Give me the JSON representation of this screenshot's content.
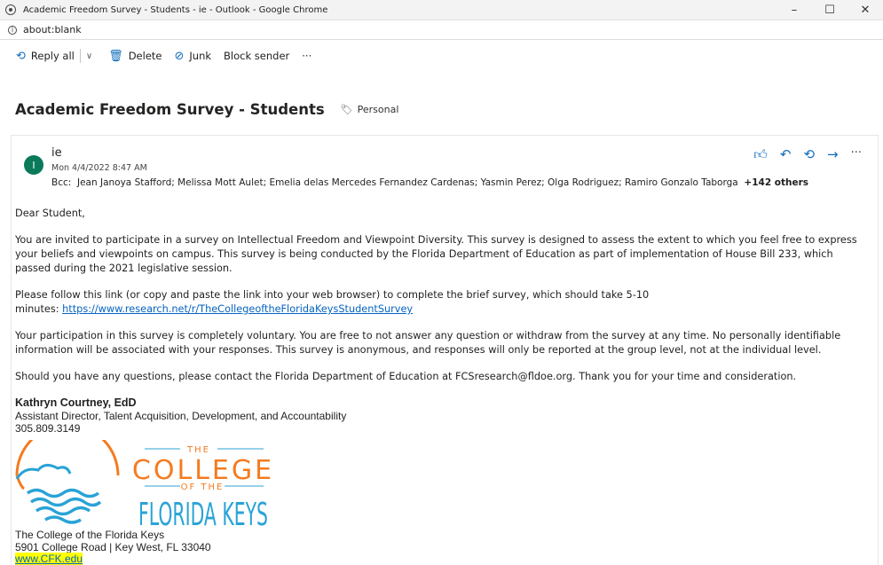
{
  "window": {
    "title": "Academic Freedom Survey - Students - ie - Outlook - Google Chrome",
    "minimize": "–",
    "maximize": "☐",
    "close": "✕"
  },
  "address": {
    "url": "about:blank"
  },
  "toolbar": {
    "reply_all": "Reply all",
    "delete": "Delete",
    "junk": "Junk",
    "block_sender": "Block sender",
    "more": "···"
  },
  "subject": {
    "text": "Academic Freedom Survey - Students",
    "tag": "Personal"
  },
  "message": {
    "avatar_initial": "I",
    "sender": "ie",
    "date": "Mon 4/4/2022 8:47 AM",
    "bcc_label": "Bcc:",
    "bcc_recipients": "Jean Janoya Stafford;  Melissa Mott Aulet;  Emelia delas Mercedes Fernandez Cardenas;  Yasmin Perez;  Olga Rodriguez;  Ramiro Gonzalo Taborga",
    "bcc_more": "+142 others",
    "greeting": "Dear Student,",
    "para1": "You are invited to participate in a survey on Intellectual Freedom and Viewpoint Diversity. This survey is designed to assess the extent to which you feel free to express your beliefs and viewpoints on campus. This survey is being conducted by the Florida Department of Education as part of implementation of House Bill 233, which passed during the 2021 legislative session.",
    "para2_line1": "Please follow this link (or copy and paste the link into your web browser) to complete the brief survey, which should take 5-10",
    "para2_prefix": "minutes: ",
    "survey_link": "https://www.research.net/r/TheCollegeoftheFloridaKeysStudentSurvey",
    "para3": "Your participation in this survey is completely voluntary. You are free to not answer any question or withdraw from the survey at any time. No personally identifiable information will be associated with your responses. This survey is anonymous, and responses will only be reported at the group level, not at the individual level.",
    "para4": "Should you have any questions, please contact the Florida Department of Education at FCSresearch@fldoe.org. Thank you for your time and consideration."
  },
  "signature": {
    "name": "Kathryn Courtney, EdD",
    "title": "Assistant Director, Talent Acquisition, Development, and Accountability",
    "phone": "305.809.3149",
    "logo": {
      "the": "THE",
      "college": "COLLEGE",
      "ofthe": "OF THE",
      "florida_keys": "FLORIDA KEYS"
    },
    "org": "The College of the Florida Keys",
    "address": "5901 College Road   |   Key West, FL 33040",
    "website": "www.CFK.edu"
  },
  "colors": {
    "accent": "#0f6cbd",
    "logo_orange": "#f47b20",
    "logo_blue": "#29a3d6",
    "avatar": "#0a7a5a"
  }
}
